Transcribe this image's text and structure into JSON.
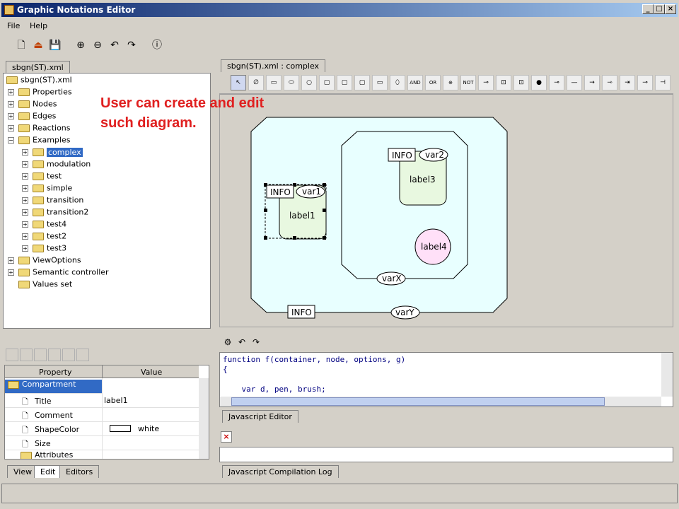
{
  "window": {
    "title": "Graphic Notations Editor",
    "min": "_",
    "max": "□",
    "close": "×"
  },
  "menu": [
    "File",
    "Help"
  ],
  "left_tab": "sbgn(ST).xml",
  "right_tab": "sbgn(ST).xml : complex",
  "tree": {
    "root": "sbgn(ST).xml",
    "items": [
      "Properties",
      "Nodes",
      "Edges",
      "Reactions",
      "Examples"
    ],
    "examples": [
      "complex",
      "modulation",
      "test",
      "simple",
      "transition",
      "transition2",
      "test4",
      "test2",
      "test3"
    ],
    "after": [
      "ViewOptions",
      "Semantic controller",
      "Values set"
    ],
    "selected": "complex"
  },
  "annotation": {
    "line1": "User can create and edit",
    "line2": "such diagram."
  },
  "diagram": {
    "outer_info": "INFO",
    "outer_var": "varY",
    "inner_var": "varX",
    "label1": "label1",
    "label1_info": "INFO",
    "label1_var": "var1",
    "label3": "label3",
    "label3_info": "INFO",
    "label3_var": "var2",
    "label4": "label4"
  },
  "palette": [
    "AND",
    "OR",
    "NOT"
  ],
  "code": {
    "line1": "function f(container, node, options, g)",
    "line2": "{",
    "line3": "    var d, pen, brush;"
  },
  "js_tab": "Javascript Editor",
  "log_tab": "Javascript Compilation Log",
  "properties": {
    "col_property": "Property",
    "col_value": "Value",
    "rows": [
      {
        "name": "Compartment",
        "value": ""
      },
      {
        "name": "Title",
        "value": "label1"
      },
      {
        "name": "Comment",
        "value": ""
      },
      {
        "name": "ShapeColor",
        "value": "white"
      },
      {
        "name": "Size",
        "value": ""
      },
      {
        "name": "Attributes",
        "value": ""
      }
    ]
  },
  "bottom_tabs": [
    "View",
    "Edit",
    "Editors"
  ],
  "colors": {
    "outer_fill": "#e8ffff",
    "label_fill": "#e8f8e0",
    "label4_fill": "#ffe0f8",
    "annotation": "#e02020"
  }
}
